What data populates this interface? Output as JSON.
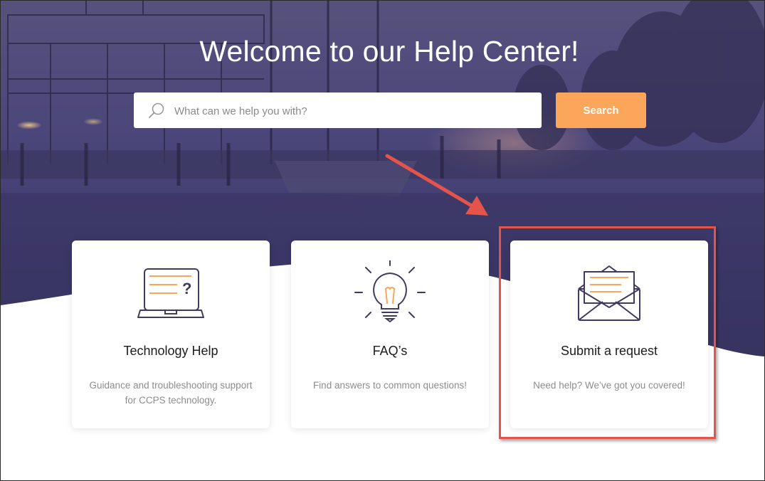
{
  "hero": {
    "title": "Welcome to our Help Center!"
  },
  "search": {
    "placeholder": "What can we help you with?",
    "button_label": "Search",
    "button_color": "#fba65a"
  },
  "cards": [
    {
      "title": "Technology Help",
      "description": "Guidance and troubleshooting support for CCPS technology.",
      "icon": "laptop-question-icon"
    },
    {
      "title": "FAQ’s",
      "description": "Find answers to common questions!",
      "icon": "lightbulb-icon"
    },
    {
      "title": "Submit a request",
      "description": "Need help? We’ve got you covered!",
      "icon": "envelope-letter-icon"
    }
  ],
  "annotations": {
    "highlight_color": "#e5544b",
    "highlighted_card": "Submit a request"
  },
  "colors": {
    "hero_overlay": "#4c477a",
    "accent": "#fba65a",
    "icon_stroke": "#3f3a60"
  }
}
